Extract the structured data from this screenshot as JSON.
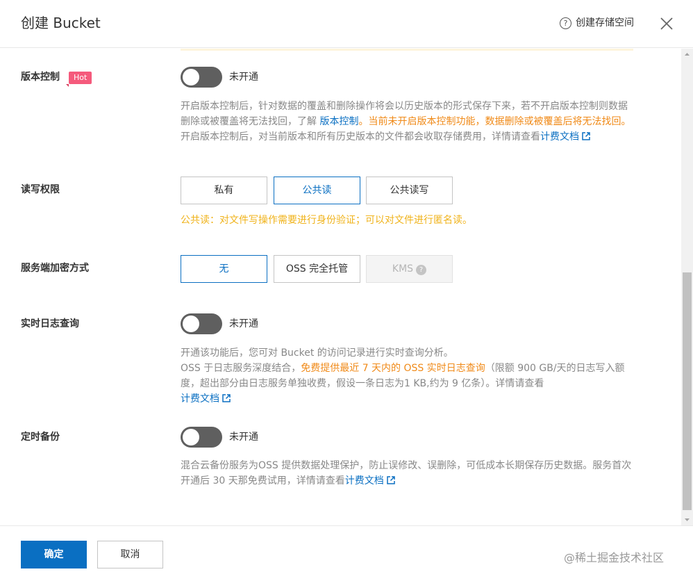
{
  "header": {
    "title": "创建 Bucket",
    "help_label": "创建存储空间",
    "help_icon": "question-circle-icon",
    "close_icon": "close-icon"
  },
  "versioning": {
    "label": "版本控制",
    "badge": "Hot",
    "state": "未开通",
    "desc1_text": "开启版本控制后，针对数据的覆盖和删除操作将会以历史版本的形式保存下来，若不开启版本控制则数据删除或被覆盖将无法找回，了解 ",
    "desc1_link": "版本控制",
    "desc1_warn": "。当前未开启版本控制功能，数据删除或被覆盖后将无法找回。",
    "desc2_text": "开启版本控制后，对当前版本和所有历史版本的文件都会收取存储费用，详情请查看",
    "desc2_link": "计费文档"
  },
  "permission": {
    "label": "读写权限",
    "options": [
      "私有",
      "公共读",
      "公共读写"
    ],
    "selected": "公共读",
    "tip": "公共读：对文件写操作需要进行身份验证；可以对文件进行匿名读。"
  },
  "encryption": {
    "label": "服务端加密方式",
    "options": [
      "无",
      "OSS 完全托管",
      "KMS"
    ],
    "selected": "无",
    "disabled": "KMS"
  },
  "realtime_log": {
    "label": "实时日志查询",
    "state": "未开通",
    "desc_line1": "开通该功能后，您可对 Bucket 的访问记录进行实时查询分析。",
    "desc_text_a": "OSS 于日志服务深度结合，",
    "desc_warn": "免费提供最近 7 天内的 OSS 实时日志查询",
    "desc_text_b": "（限额 900 GB/天的日志写入额度，超出部分由日志服务单独收费，假设一条日志为1 KB,约为 9 亿条）。详情请查看",
    "desc_link": "计费文档"
  },
  "scheduled_backup": {
    "label": "定时备份",
    "state": "未开通",
    "desc_text": "混合云备份服务为OSS 提供数据处理保护，防止误修改、误删除，可低成本长期保存历史数据。服务首次开通后 30 天那免费试用，详情请查看",
    "desc_link": "计费文档"
  },
  "footer": {
    "confirm": "确定",
    "cancel": "取消",
    "watermark": "@稀土掘金技术社区"
  },
  "colors": {
    "primary": "#0a6fc2",
    "warn": "#f08a18",
    "tip": "#f0b31b",
    "hot_badge": "#f55a7c",
    "toggle_off": "#5f5f5f"
  }
}
